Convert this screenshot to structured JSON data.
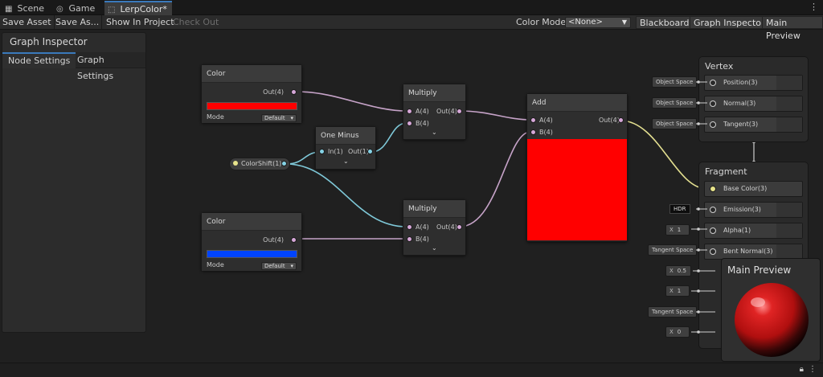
{
  "tabs": [
    {
      "icon": "grid-icon",
      "label": "Scene"
    },
    {
      "icon": "gamepad-icon",
      "label": "Game"
    },
    {
      "icon": "shadergraph-icon",
      "label": "LerpColor*"
    }
  ],
  "toolbar": {
    "save_asset": "Save Asset",
    "save_as": "Save As...",
    "show_in_project": "Show In Project",
    "check_out": "Check Out",
    "color_mode_label": "Color Mode",
    "color_mode_value": "<None>",
    "blackboard": "Blackboard",
    "graph_inspector": "Graph Inspector",
    "main_preview": "Main Preview"
  },
  "inspector": {
    "title": "Graph Inspector",
    "tabs": [
      "Node Settings",
      "Graph Settings"
    ]
  },
  "nodes": {
    "color1": {
      "title": "Color",
      "out": "Out(4)",
      "mode_label": "Mode",
      "mode_value": "Default",
      "swatch": "#ff0000"
    },
    "color2": {
      "title": "Color",
      "out": "Out(4)",
      "mode_label": "Mode",
      "mode_value": "Default",
      "swatch": "#0044ff"
    },
    "one_minus": {
      "title": "One Minus",
      "in": "In(1)",
      "out": "Out(1)"
    },
    "multiply1": {
      "title": "Multiply",
      "a": "A(4)",
      "b": "B(4)",
      "out": "Out(4)"
    },
    "multiply2": {
      "title": "Multiply",
      "a": "A(4)",
      "b": "B(4)",
      "out": "Out(4)"
    },
    "add": {
      "title": "Add",
      "a": "A(4)",
      "b": "B(4)",
      "out": "Out(4)",
      "preview_color": "#ff0000"
    },
    "property": {
      "label": "ColorShift(1)"
    }
  },
  "vertex": {
    "title": "Vertex",
    "blocks": [
      {
        "label": "Position(3)",
        "input": "Object Space"
      },
      {
        "label": "Normal(3)",
        "input": "Object Space"
      },
      {
        "label": "Tangent(3)",
        "input": "Object Space"
      }
    ]
  },
  "fragment": {
    "title": "Fragment",
    "blocks": [
      {
        "label": "Base Color(3)",
        "input": ""
      },
      {
        "label": "Emission(3)",
        "input": "HDR"
      },
      {
        "label": "Alpha(1)",
        "input_x": "X",
        "input_val": "1"
      },
      {
        "label": "Bent Normal(3)",
        "input": "Tangent Space"
      }
    ],
    "extra_inputs": [
      {
        "x": "X",
        "val": "0.5"
      },
      {
        "x": "X",
        "val": "1"
      },
      {
        "text": "Tangent Space"
      },
      {
        "x": "X",
        "val": "0"
      }
    ]
  },
  "preview": {
    "title": "Main Preview"
  },
  "colors": {
    "wire_pink": "#c6a3c8",
    "wire_cyan": "#7fc9d9",
    "wire_yellow": "#e3df90",
    "accent": "#3a79bb"
  }
}
